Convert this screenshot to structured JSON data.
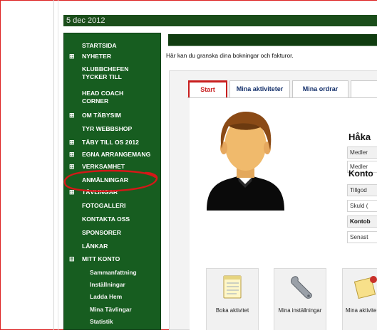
{
  "date": "5 dec 2012",
  "sidebar": {
    "items": [
      {
        "label": "STARTSIDA",
        "expand": ""
      },
      {
        "label": "NYHETER",
        "expand": "⊞"
      },
      {
        "label": "KLUBBCHEFEN TYCKER TILL",
        "expand": ""
      },
      {
        "label": "HEAD COACH CORNER",
        "expand": ""
      },
      {
        "label": "OM TÄBYSIM",
        "expand": "⊞"
      },
      {
        "label": "TYR WEBBSHOP",
        "expand": ""
      },
      {
        "label": "TÄBY TILL OS 2012",
        "expand": "⊞"
      },
      {
        "label": "EGNA ARRANGEMANG",
        "expand": "⊞"
      },
      {
        "label": "VERKSAMHET",
        "expand": "⊞"
      },
      {
        "label": "ANMÄLNINGAR",
        "expand": ""
      },
      {
        "label": "TÄVLINGAR",
        "expand": "⊞"
      },
      {
        "label": "FOTOGALLERI",
        "expand": ""
      },
      {
        "label": "KONTAKTA OSS",
        "expand": ""
      },
      {
        "label": "SPONSORER",
        "expand": ""
      },
      {
        "label": "LÄNKAR",
        "expand": ""
      },
      {
        "label": "MITT KONTO",
        "expand": "⊟"
      }
    ],
    "subitems": [
      "Sammanfattning",
      "Inställningar",
      "Ladda Hem",
      "Mina Tävlingar",
      "Statistik"
    ]
  },
  "intro_text": "Här kan du granska dina bokningar och fakturor.",
  "tabs": [
    {
      "label": "Start",
      "active": true
    },
    {
      "label": "Mina aktiviteter",
      "active": false
    },
    {
      "label": "Mina ordrar",
      "active": false
    }
  ],
  "profile": {
    "name": "Håka",
    "rows": [
      "Medler",
      "Medler"
    ]
  },
  "account": {
    "title": "Konto",
    "rows": [
      "Tillgod",
      "Skuld (",
      "Kontob",
      "Senast"
    ]
  },
  "quick_buttons": [
    {
      "label": "Boka aktivitet",
      "icon": "notepad-icon"
    },
    {
      "label": "Mina inställningar",
      "icon": "wrench-icon"
    },
    {
      "label": "Mina aktivite",
      "icon": "notes-icon"
    }
  ],
  "colors": {
    "sidebar_bg": "#175d20",
    "topbar_bg": "#103c10",
    "active_tab": "#c81e1e",
    "annotation": "#d31818"
  }
}
